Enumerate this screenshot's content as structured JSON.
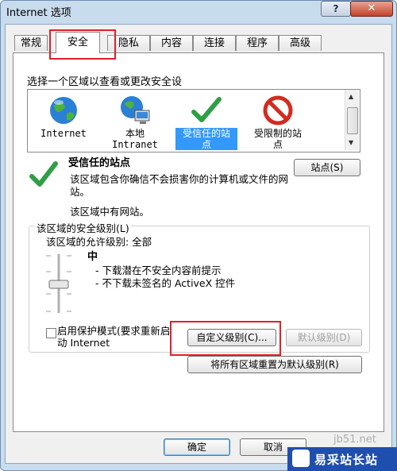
{
  "window": {
    "title": "Internet 选项",
    "help_label": "?",
    "close_label": "✕"
  },
  "tabs": [
    {
      "label": "常规"
    },
    {
      "label": "安全"
    },
    {
      "label": "隐私"
    },
    {
      "label": "内容"
    },
    {
      "label": "连接"
    },
    {
      "label": "程序"
    },
    {
      "label": "高级"
    }
  ],
  "active_tab": "安全",
  "security": {
    "prompt": "选择一个区域以查看或更改安全设",
    "zones": [
      {
        "line1": "Internet",
        "line2": "",
        "icon": "globe-icon"
      },
      {
        "line1": "本地",
        "line2": "Intranet",
        "icon": "network-globe-icon"
      },
      {
        "line1": "受信任的站",
        "line2": "点",
        "icon": "checkmark-icon",
        "selected": true
      },
      {
        "line1": "受限制的站",
        "line2": "点",
        "icon": "no-entry-icon"
      }
    ],
    "zone_title": "受信任的站点",
    "zone_desc": "该区域包含你确信不会损害你的计算机或文件的网站。",
    "zone_sites": "该区域中有网站。",
    "sites_button": "站点(S)",
    "level_group_title": "该区域的安全级别(L)",
    "allowed_levels": "该区域的允许级别: 全部",
    "level_name": "中",
    "level_desc": [
      "- 下载潜在不安全内容前提示",
      "- 不下载未签名的 ActiveX 控件"
    ],
    "protected_mode": "启用保护模式(要求重新启动 Internet",
    "custom_button": "自定义级别(C)...",
    "default_button": "默认级别(D)",
    "reset_button": "将所有区域重置为默认级别(R)"
  },
  "footer": {
    "ok": "确定",
    "cancel": "取消"
  },
  "watermark": {
    "url": "jb51.net",
    "text": "易采站长站"
  },
  "colors": {
    "highlight_box": "#e0202a",
    "selection": "#3399ff",
    "title_bg": "#c9dcee",
    "watermark_bg": "#1f4fae"
  }
}
